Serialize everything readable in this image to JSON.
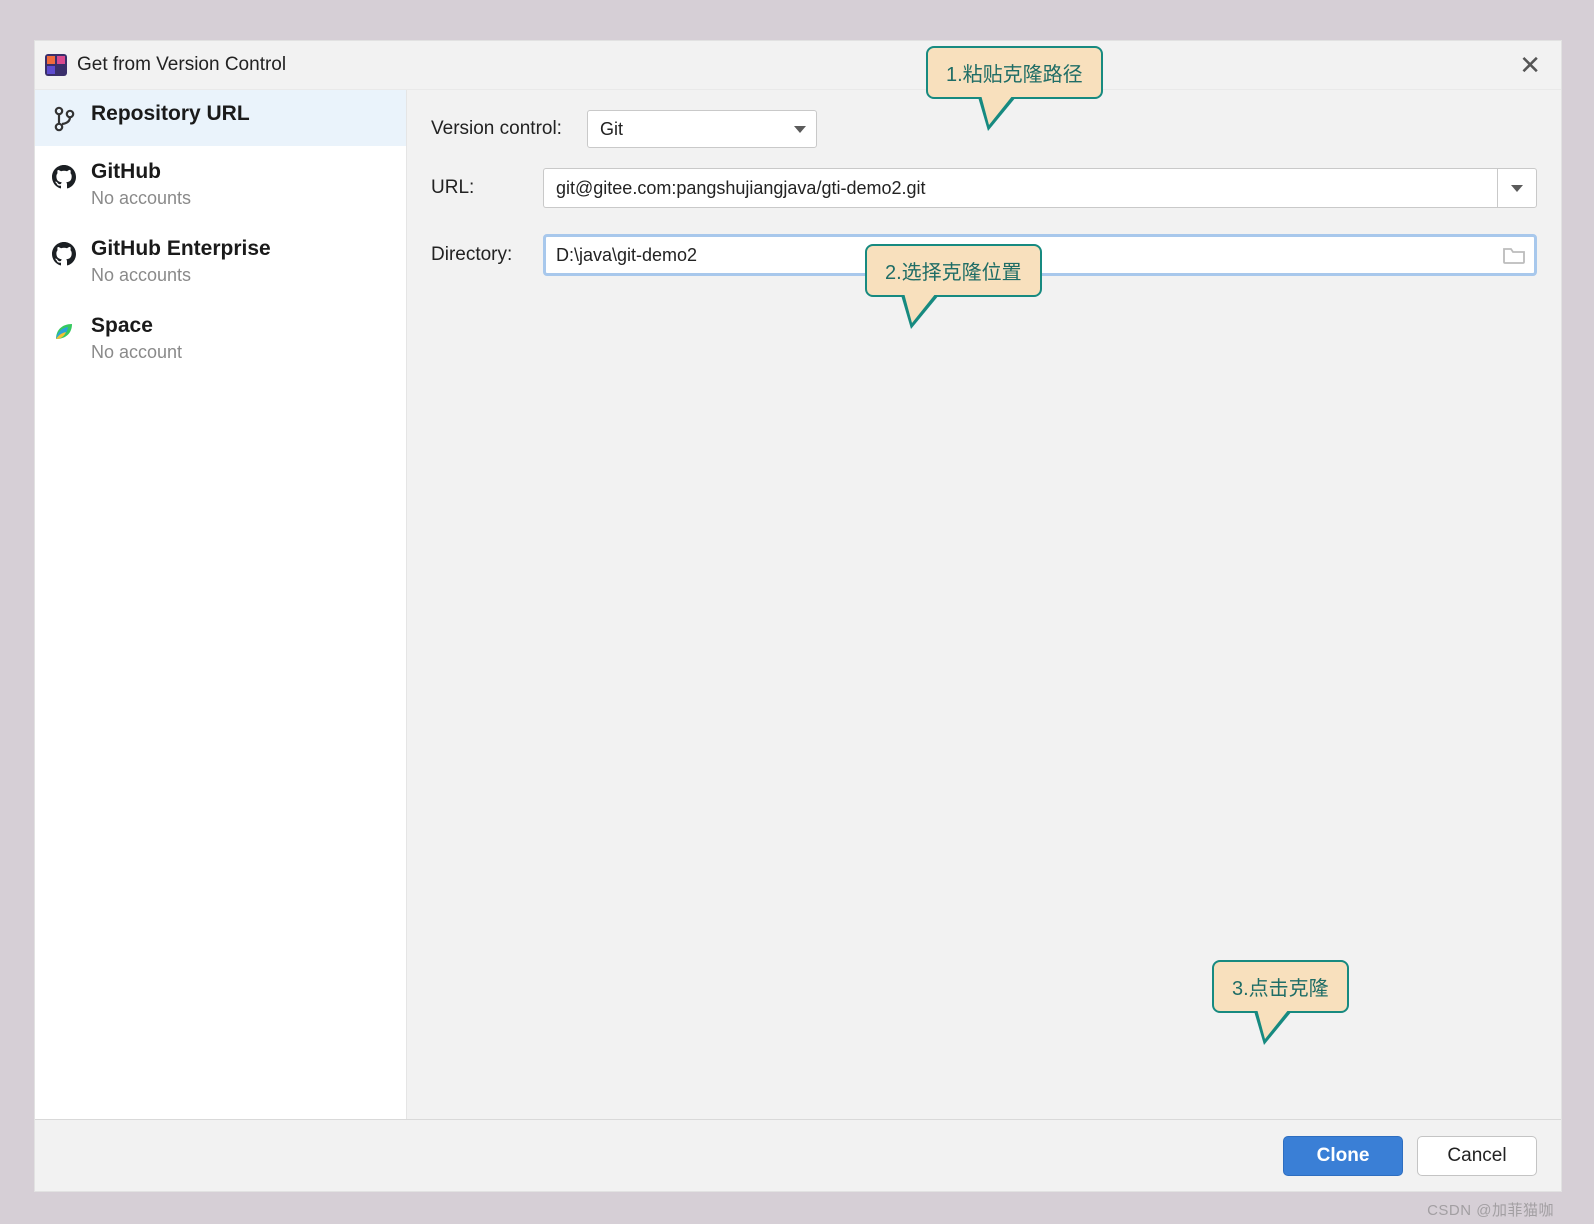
{
  "dialog": {
    "title": "Get from Version Control"
  },
  "sidebar": {
    "items": [
      {
        "label": "Repository URL",
        "sub": ""
      },
      {
        "label": "GitHub",
        "sub": "No accounts"
      },
      {
        "label": "GitHub Enterprise",
        "sub": "No accounts"
      },
      {
        "label": "Space",
        "sub": "No account"
      }
    ]
  },
  "form": {
    "version_control_label": "Version control:",
    "version_control_value": "Git",
    "url_label": "URL:",
    "url_value": "git@gitee.com:pangshujiangjava/gti-demo2.git",
    "directory_label": "Directory:",
    "directory_value": "D:\\java\\git-demo2"
  },
  "buttons": {
    "clone": "Clone",
    "cancel": "Cancel"
  },
  "callouts": {
    "c1": "1.粘贴克隆路径",
    "c2": "2.选择克隆位置",
    "c3": "3.点击克隆"
  },
  "watermark": "CSDN @加菲猫咖"
}
